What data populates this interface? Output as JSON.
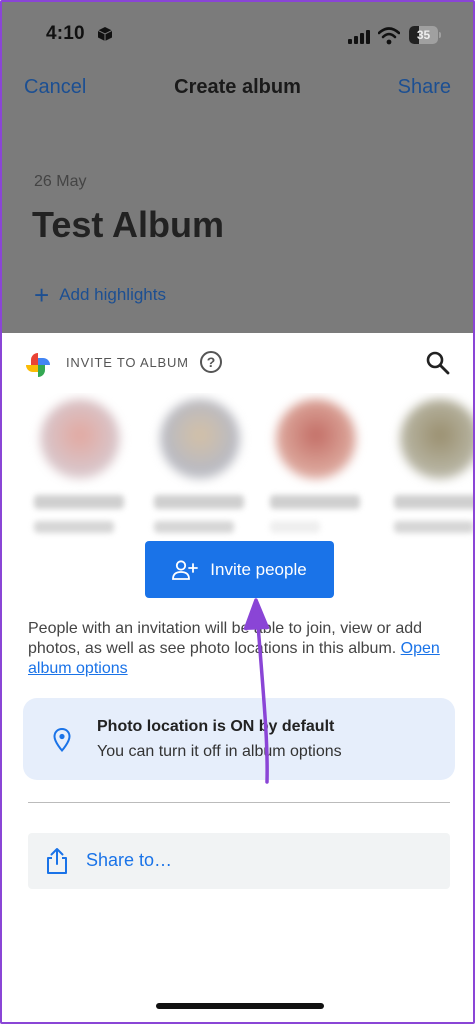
{
  "status_bar": {
    "time": "4:10",
    "battery_level": "35"
  },
  "nav": {
    "cancel_label": "Cancel",
    "title": "Create album",
    "share_label": "Share"
  },
  "album": {
    "date": "26 May",
    "title": "Test Album",
    "add_highlights_label": "Add highlights"
  },
  "sheet": {
    "invite_label": "INVITE TO ALBUM",
    "help_glyph": "?",
    "invite_button_label": "Invite people",
    "info_text": "People with an invitation will be able to join, view or add photos, as well as see photo locations in this album. ",
    "info_link": "Open album options",
    "location_title": "Photo location is ON by default",
    "location_subtitle": "You can turn it off in album options",
    "share_to_label": "Share to…"
  },
  "colors": {
    "accent": "#1a73e8",
    "dim_link": "#1c4f92",
    "annotation_arrow": "#8a45d6"
  },
  "icons": [
    "cube-icon",
    "signal-icon",
    "wifi-icon",
    "battery-icon",
    "plus-icon",
    "google-photos-logo",
    "help-icon",
    "search-icon",
    "add-person-icon",
    "location-pin-icon",
    "share-icon"
  ]
}
